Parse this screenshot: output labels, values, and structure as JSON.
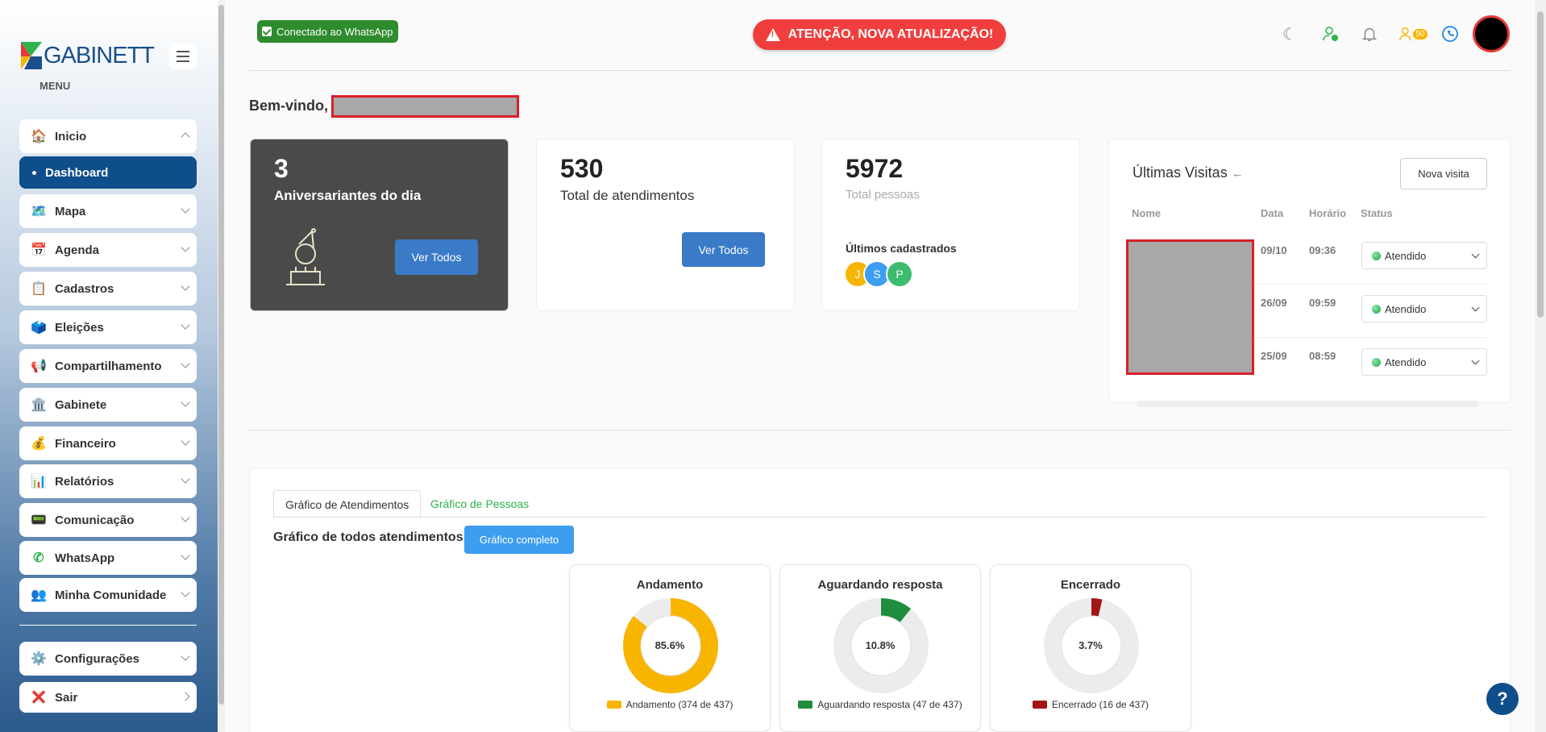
{
  "sidebar": {
    "logo": "GABINETT",
    "menu_label": "MENU",
    "items": [
      {
        "label": "Inicio",
        "icon": "house-icon"
      },
      {
        "label": "Dashboard"
      },
      {
        "label": "Mapa",
        "icon": "map-icon"
      },
      {
        "label": "Agenda",
        "icon": "calendar-icon"
      },
      {
        "label": "Cadastros",
        "icon": "clipboard-icon"
      },
      {
        "label": "Eleições",
        "icon": "ballot-icon"
      },
      {
        "label": "Compartilhamento",
        "icon": "megaphone-icon"
      },
      {
        "label": "Gabinete",
        "icon": "building-icon"
      },
      {
        "label": "Financeiro",
        "icon": "money-bag-icon"
      },
      {
        "label": "Relatórios",
        "icon": "bar-chart-icon"
      },
      {
        "label": "Comunicação",
        "icon": "dialpad-icon"
      },
      {
        "label": "WhatsApp",
        "icon": "whatsapp-icon"
      },
      {
        "label": "Minha Comunidade",
        "icon": "people-icon"
      },
      {
        "label": "Configurações",
        "icon": "gear-icon"
      },
      {
        "label": "Sair",
        "icon": "x-icon"
      }
    ]
  },
  "topbar": {
    "whatsapp_status": "Conectado ao WhatsApp",
    "alert": "ATENÇÃO, NOVA ATUALIZAÇÃO!",
    "badge_count": "50"
  },
  "welcome": "Bem-vindo,",
  "cards": {
    "birthdays": {
      "value": "3",
      "label": "Aniversariantes do dia",
      "button": "Ver Todos"
    },
    "attendances": {
      "value": "530",
      "label": "Total de atendimentos",
      "button": "Ver Todos"
    },
    "people": {
      "value": "5972",
      "label": "Total pessoas",
      "recent_title": "Últimos cadastrados",
      "recent": [
        "J",
        "S",
        "P"
      ]
    }
  },
  "visits": {
    "title": "Últimas Visitas",
    "new_button": "Nova visita",
    "headers": [
      "Nome",
      "Data",
      "Horário",
      "Status"
    ],
    "rows": [
      {
        "date": "09/10",
        "time": "09:36",
        "status": "Atendido"
      },
      {
        "date": "26/09",
        "time": "09:59",
        "status": "Atendido"
      },
      {
        "date": "25/09",
        "time": "08:59",
        "status": "Atendido"
      }
    ]
  },
  "charts": {
    "tabs": [
      "Gráfico de Atendimentos",
      "Gráfico de Pessoas"
    ],
    "title": "Gráfico de todos atendimentos!",
    "full_button": "Gráfico completo",
    "donuts": [
      {
        "title": "Andamento",
        "pct": "85.6%",
        "fraction": 0.856,
        "color": "#f8b500",
        "legend": "Andamento (374 de 437)"
      },
      {
        "title": "Aguardando resposta",
        "pct": "10.8%",
        "fraction": 0.108,
        "color": "#1e8e3e",
        "legend": "Aguardando resposta (47 de 437)"
      },
      {
        "title": "Encerrado",
        "pct": "3.7%",
        "fraction": 0.037,
        "color": "#a31515",
        "legend": "Encerrado (16 de 437)"
      }
    ]
  },
  "help": "?",
  "colors": {
    "primary": "#0e4e8a",
    "accent": "#3a7ac6",
    "alert": "#f03e3e"
  }
}
